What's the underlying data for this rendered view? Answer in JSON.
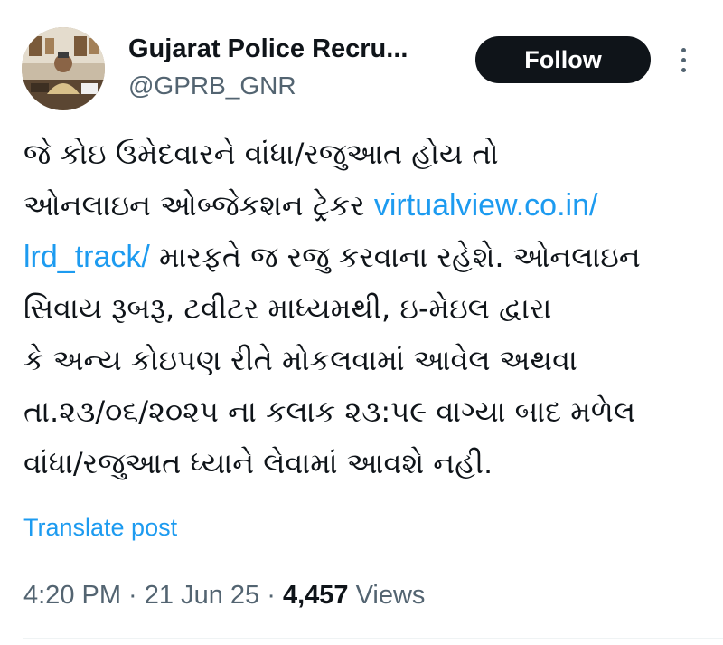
{
  "author": {
    "display_name": "Gujarat Police Recru...",
    "handle": "@GPRB_GNR",
    "avatar_icon": "profile-photo-icon"
  },
  "header": {
    "follow_label": "Follow",
    "more_icon": "more-vertical-icon"
  },
  "post": {
    "line1": "જે કોઇ ઉમેદવારને વાંધા/રજુઆત હોય તો",
    "line2_text": "ઓનલાઇન ઓબ્જેકશન ટ્રેકર ",
    "line2_link": "virtualview.co.in/",
    "line3_link": "lrd_track/",
    "line3_text": " મારફતે જ રજુ કરવાના રહેશે. ઓનલાઇન",
    "line4": "સિવાય રૂબરૂ, ટવીટર માધ્યમથી, ઇ-મેઇલ દ્વારા",
    "line5": "કે અન્ય કોઇપણ રીતે મોકલવામાં આવેલ અથવા",
    "line6": "તા.૨૩/૦૬/૨૦૨૫ ના કલાક ૨૩:૫૯ વાગ્યા બાદ મળેલ",
    "line7": "વાંધા/રજુઆત ધ્યાને લેવામાં આવશે નહી."
  },
  "translate_label": "Translate post",
  "meta": {
    "time": "4:20 PM",
    "separator": " · ",
    "date": "21 Jun 25",
    "views_count": "4,457",
    "views_label": " Views"
  },
  "colors": {
    "link": "#1d9bf0",
    "text": "#0f1419",
    "secondary": "#536471",
    "button_bg": "#0f1419"
  }
}
